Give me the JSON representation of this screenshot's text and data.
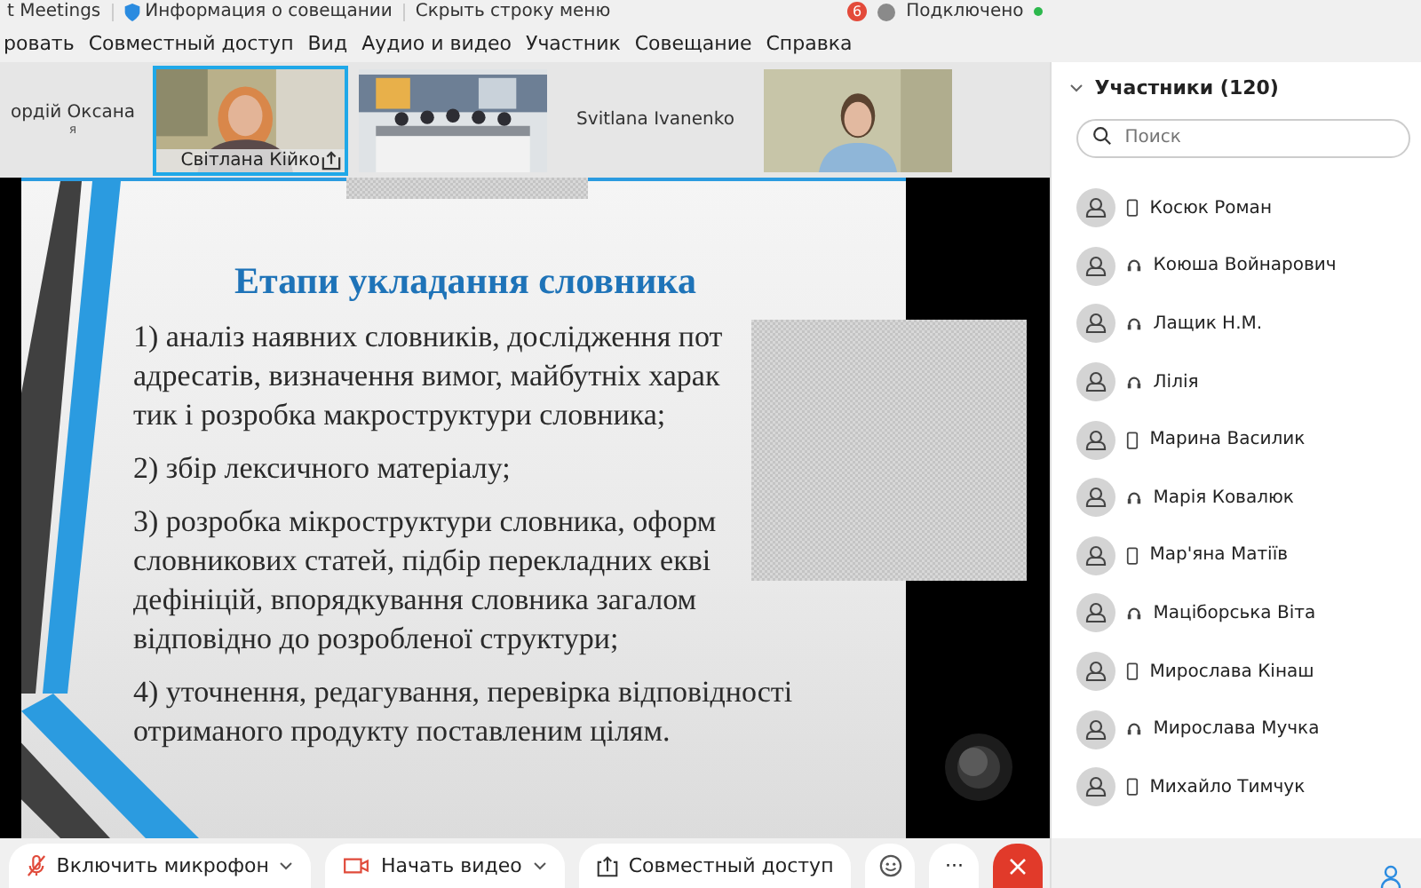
{
  "titlebar": {
    "app": "t Meetings",
    "meeting_info": "Информация о совещании",
    "hide_menu": "Скрыть строку меню",
    "badge": "6",
    "status": "Подключено"
  },
  "menu": [
    "ровать",
    "Совместный доступ",
    "Вид",
    "Аудио и видео",
    "Участник",
    "Совещание",
    "Справка"
  ],
  "tiles": [
    {
      "kind": "name",
      "name": "ордій Оксана",
      "sub": "я",
      "active": false
    },
    {
      "kind": "video",
      "name": "Світлана Кійко",
      "active": true
    },
    {
      "kind": "video",
      "active": false
    },
    {
      "kind": "name",
      "name": "Svitlana Ivanenko",
      "active": false
    },
    {
      "kind": "video",
      "active": false
    }
  ],
  "slide": {
    "title": "Етапи укладання словника",
    "items": [
      {
        "lines": [
          "1) аналіз наявних словників, дослідження пот",
          "адресатів, визначення вимог, майбутніх харак",
          "тик і розробка макроструктури словника;"
        ]
      },
      {
        "lines": [
          "2) збір лексичного матеріалу;"
        ]
      },
      {
        "lines": [
          "3) розробка мікроструктури словника, оформ",
          "словникових статей, підбір перекладних екві",
          "дефініцій, впорядкування словника загалом",
          "відповідно до розробленої структури;"
        ]
      },
      {
        "lines": [
          "4) уточнення, редагування, перевірка відповідності",
          "отриманого продукту поставленим цілям."
        ]
      }
    ]
  },
  "participants": {
    "title": "Участники (120)",
    "search": {
      "placeholder": "Поиск"
    },
    "items": [
      {
        "name": "Косюк Роман",
        "kind": "mobile"
      },
      {
        "name": "Коюша Войнарович",
        "kind": "audio"
      },
      {
        "name": "Лащик Н.М.",
        "kind": "audio"
      },
      {
        "name": "Лілія",
        "kind": "audio"
      },
      {
        "name": "Марина Василик",
        "kind": "mobile"
      },
      {
        "name": "Марія Ковалюк",
        "kind": "audio"
      },
      {
        "name": "Мар'яна Матіїв",
        "kind": "mobile"
      },
      {
        "name": "Маціборська Віта",
        "kind": "audio"
      },
      {
        "name": "Мирослава Кінаш",
        "kind": "mobile"
      },
      {
        "name": "Мирослава Мучка",
        "kind": "audio"
      },
      {
        "name": "Михайло Тимчук",
        "kind": "mobile"
      }
    ]
  },
  "toolbar": [
    {
      "kind": "mic",
      "label": "Включить микрофон"
    },
    {
      "kind": "video",
      "label": "Начать видео"
    },
    {
      "kind": "share",
      "label": "Совместный доступ"
    },
    {
      "kind": "emoji"
    },
    {
      "kind": "more",
      "label": "···"
    },
    {
      "kind": "leave"
    }
  ]
}
